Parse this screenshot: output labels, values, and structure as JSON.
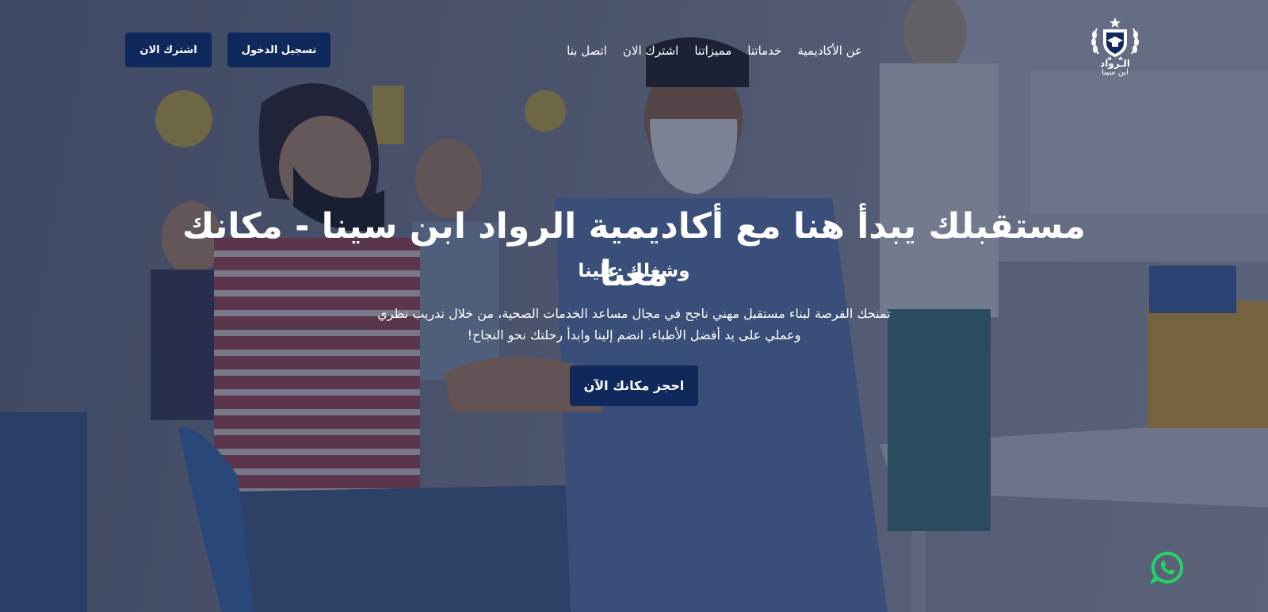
{
  "brand": {
    "logo_title": "الـرواد",
    "logo_subtitle": "ابن سينا",
    "accent_color": "#10295c"
  },
  "nav": {
    "items": [
      {
        "label": "عن الأكاديمية"
      },
      {
        "label": "خدماتنا"
      },
      {
        "label": "مميزاتنا"
      },
      {
        "label": "اشترك الان"
      },
      {
        "label": "اتصل بنا"
      }
    ]
  },
  "header_buttons": {
    "login": "تسجيل الدخول",
    "subscribe": "اشترك الان"
  },
  "hero": {
    "title_line1": "مستقبلك يبدأ هنا مع أكاديمية الرواد ابن سينا - مكانك معنا",
    "title_line2": "وشغلك علينا",
    "description": "تمنحك الفرصة لبناء مستقبل مهني ناجح في مجال مساعد الخدمات الصحية، من خلال تدريب نظري وعملي على يد أفضل الأطباء. انضم إلينا وابدأ رحلتك نحو النجاح!",
    "cta_label": "احجز مكانك الآن"
  },
  "floating": {
    "whatsapp_icon": "whatsapp-icon",
    "whatsapp_color": "#25d366"
  }
}
